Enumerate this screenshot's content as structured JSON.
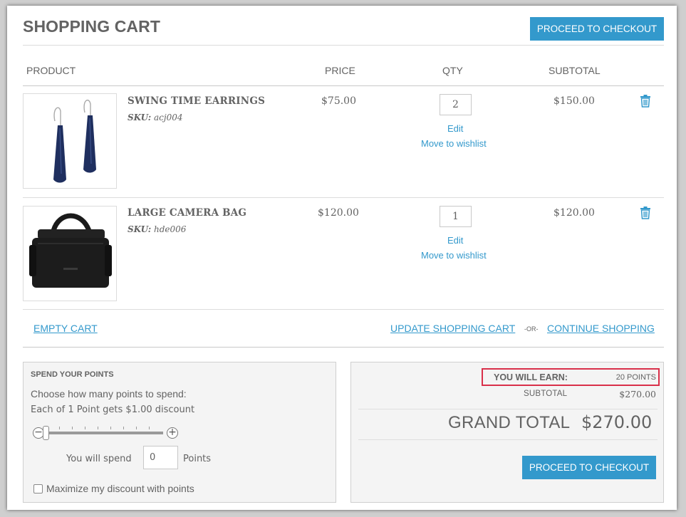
{
  "title": "SHOPPING CART",
  "checkout_label": "PROCEED TO CHECKOUT",
  "columns": {
    "product": "PRODUCT",
    "price": "PRICE",
    "qty": "QTY",
    "subtotal": "SUBTOTAL"
  },
  "items": [
    {
      "name": "SWING TIME EARRINGS",
      "sku_label": "SKU:",
      "sku": "acj004",
      "price": "$75.00",
      "qty": "2",
      "edit": "Edit",
      "wishlist": "Move to wishlist",
      "subtotal": "$150.00",
      "image": "earrings"
    },
    {
      "name": "LARGE CAMERA BAG",
      "sku_label": "SKU:",
      "sku": "hde006",
      "price": "$120.00",
      "qty": "1",
      "edit": "Edit",
      "wishlist": "Move to wishlist",
      "subtotal": "$120.00",
      "image": "camera-bag"
    }
  ],
  "actions": {
    "empty": "EMPTY CART",
    "update": "UPDATE SHOPPING CART",
    "or": "-OR-",
    "continue": "CONTINUE SHOPPING"
  },
  "points": {
    "title": "SPEND YOUR POINTS",
    "choose": "Choose how many points to spend:",
    "each": "Each of 1 Point gets $1.00 discount",
    "minus": "−",
    "plus": "+",
    "slider_value": 0,
    "spend_label": "You will spend",
    "spend_value": "0",
    "points_label": "Points",
    "maximize": "Maximize my discount with points"
  },
  "totals": {
    "earn_label": "YOU WILL EARN:",
    "earn_value": "20 POINTS",
    "subtotal_label": "SUBTOTAL",
    "subtotal_value": "$270.00",
    "grand_label": "GRAND TOTAL",
    "grand_value": "$270.00"
  },
  "colors": {
    "accent": "#3399cc",
    "highlight": "#d9304a",
    "text": "#636363"
  },
  "icons": {
    "remove": "trash-icon"
  }
}
